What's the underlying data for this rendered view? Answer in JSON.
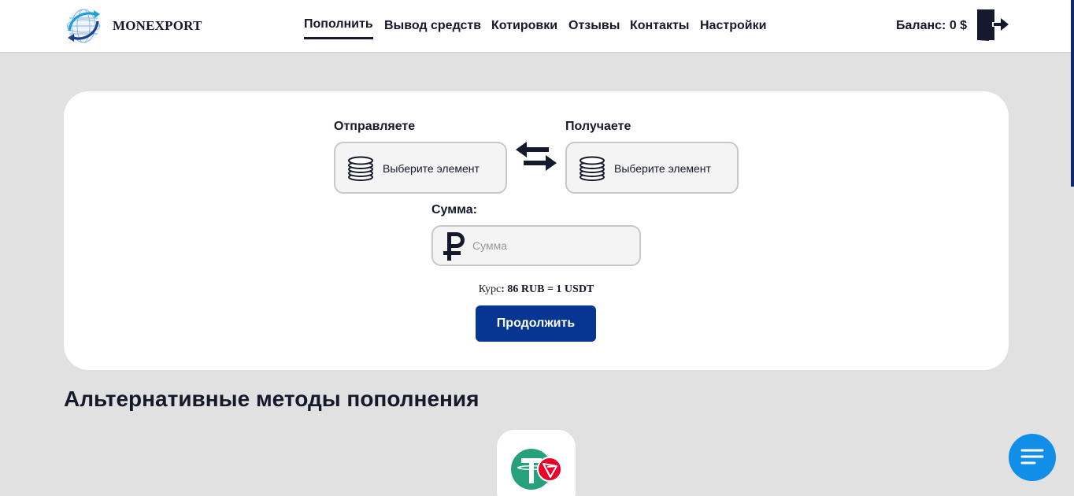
{
  "brand": {
    "name": "MONEXPORT",
    "logo_icon": "globe-arrows-icon"
  },
  "nav": {
    "items": [
      {
        "label": "Пополнить",
        "active": true
      },
      {
        "label": "Вывод средств",
        "active": false
      },
      {
        "label": "Котировки",
        "active": false
      },
      {
        "label": "Отзывы",
        "active": false
      },
      {
        "label": "Контакты",
        "active": false
      },
      {
        "label": "Настройки",
        "active": false
      }
    ]
  },
  "balance": {
    "label": "Баланс:",
    "value": "0 $"
  },
  "exchange": {
    "send": {
      "label": "Отправляете",
      "placeholder": "Выберите элемент",
      "icon": "coins-icon"
    },
    "receive": {
      "label": "Получаете",
      "placeholder": "Выберите элемент",
      "icon": "coins-icon"
    },
    "swap_icon": "swap-arrows-icon",
    "amount": {
      "label": "Сумма:",
      "placeholder": "Сумма",
      "value": "",
      "currency_icon": "ruble-icon"
    },
    "rate": {
      "label": "Курс",
      "value": ": 86 RUB = 1 USDT"
    },
    "continue_label": "Продолжить"
  },
  "alternatives": {
    "title": "Альтернативные методы пополнения",
    "methods": [
      {
        "icon": "usdt-trc20-icon"
      }
    ]
  },
  "colors": {
    "primary": "#063592",
    "text": "#14192b",
    "page_bg": "#e1e1e1",
    "chat": "#118ee8",
    "tether": "#26a17b",
    "tron": "#eb0029"
  }
}
